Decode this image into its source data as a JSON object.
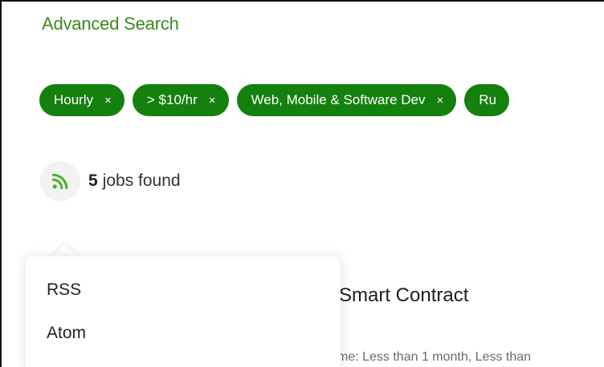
{
  "header": {
    "advanced_search_label": "Advanced Search"
  },
  "filters": {
    "chips": [
      {
        "label": "Hourly",
        "remove": "×"
      },
      {
        "label": "> $10/hr",
        "remove": "×"
      },
      {
        "label": "Web, Mobile & Software Dev",
        "remove": "×"
      },
      {
        "label": "Ru"
      }
    ]
  },
  "results": {
    "count": "5",
    "label": "jobs found",
    "rss_icon": "rss-feed-icon"
  },
  "feed_menu": {
    "items": [
      "RSS",
      "Atom"
    ]
  },
  "job": {
    "title_partial": "Smart Contract",
    "meta_partial": "me: Less than 1 month, Less than"
  },
  "colors": {
    "brand_green": "#14800e",
    "link_green": "#3a8a1f",
    "icon_green": "#4fae2c"
  }
}
